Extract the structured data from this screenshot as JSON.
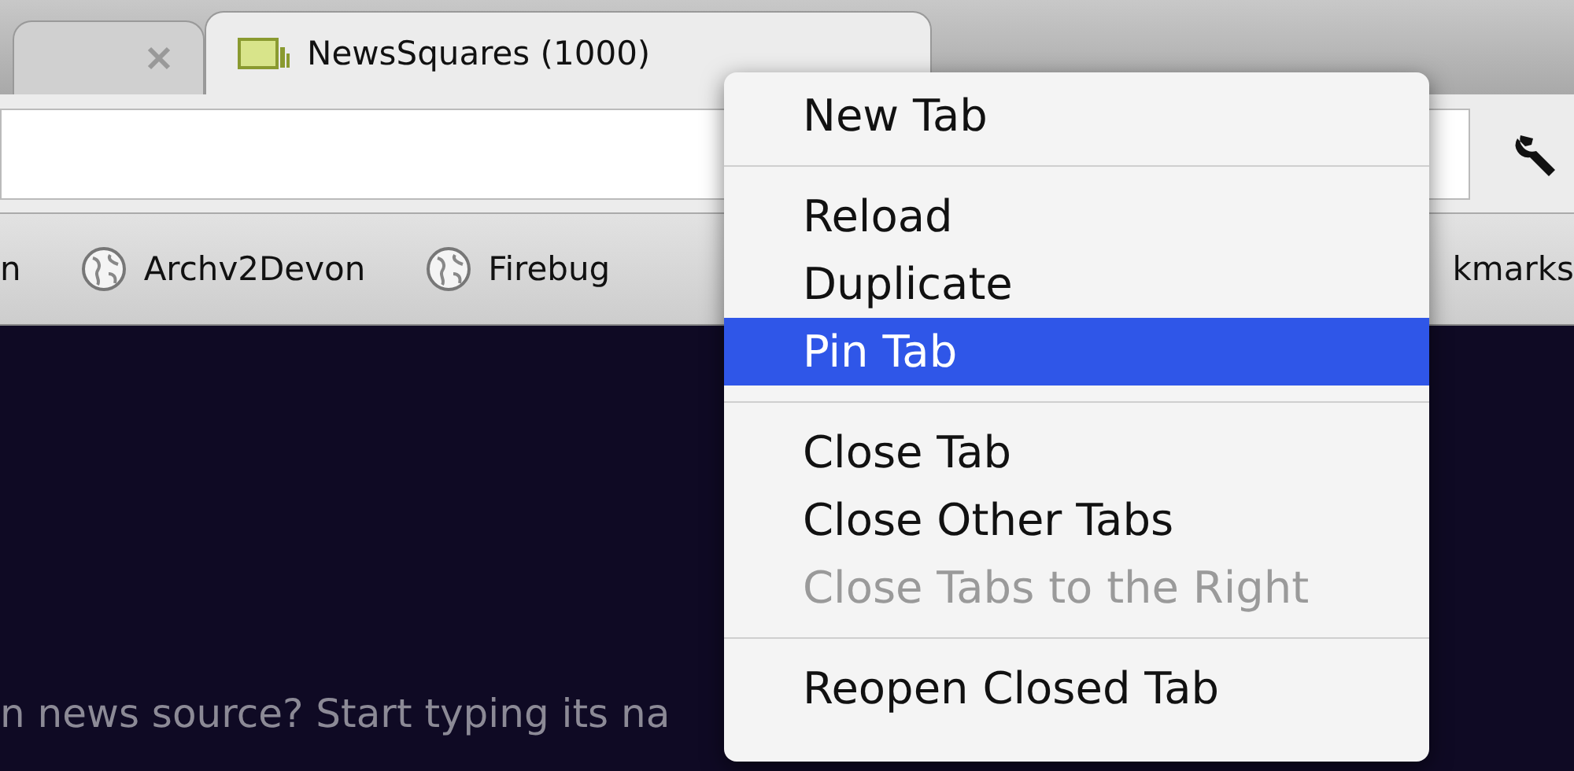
{
  "tabs": [
    {
      "selected": false,
      "closable": true
    },
    {
      "label": "NewsSquares (1000)",
      "selected": true,
      "closable": false
    }
  ],
  "bookmarks": [
    {
      "label": "n",
      "icon": false
    },
    {
      "label": "Archv2Devon",
      "icon": true
    },
    {
      "label": "Firebug",
      "icon": true
    },
    {
      "label": "kmarks",
      "icon": false
    }
  ],
  "page": {
    "prompt": "n news source? Start typing its na"
  },
  "context_menu": [
    {
      "kind": "item",
      "label": "New Tab",
      "selected": false,
      "disabled": false
    },
    {
      "kind": "separator"
    },
    {
      "kind": "item",
      "label": "Reload",
      "selected": false,
      "disabled": false
    },
    {
      "kind": "item",
      "label": "Duplicate",
      "selected": false,
      "disabled": false
    },
    {
      "kind": "item",
      "label": "Pin Tab",
      "selected": true,
      "disabled": false
    },
    {
      "kind": "separator"
    },
    {
      "kind": "item",
      "label": "Close Tab",
      "selected": false,
      "disabled": false
    },
    {
      "kind": "item",
      "label": "Close Other Tabs",
      "selected": false,
      "disabled": false
    },
    {
      "kind": "item",
      "label": "Close Tabs to the Right",
      "selected": false,
      "disabled": true
    },
    {
      "kind": "separator"
    },
    {
      "kind": "item",
      "label": "Reopen Closed Tab",
      "selected": false,
      "disabled": false
    }
  ]
}
